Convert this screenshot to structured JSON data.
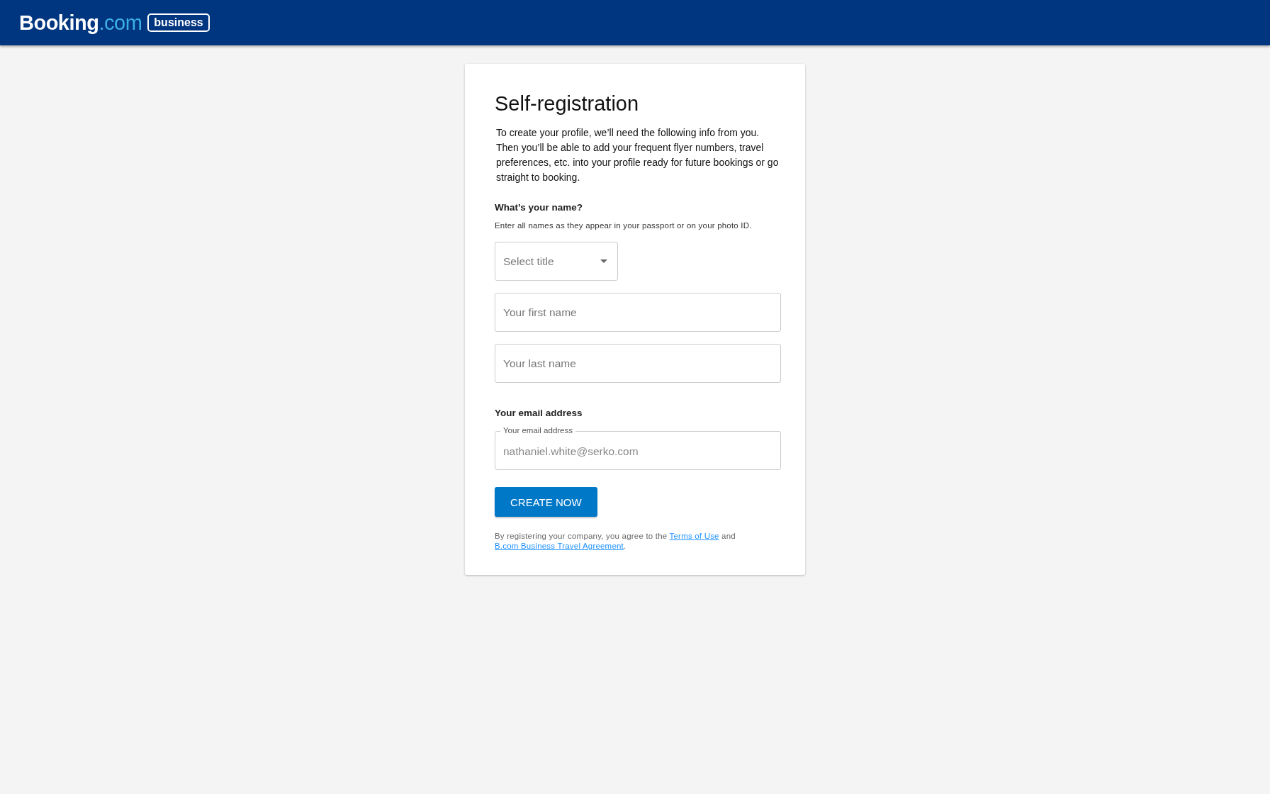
{
  "header": {
    "logo_main": "Booking",
    "logo_suffix": ".com",
    "badge": "business"
  },
  "form": {
    "title": "Self-registration",
    "intro": "To create your profile, we’ll need the following info from you. Then you’ll be able to add your frequent flyer numbers, travel preferences, etc. into your profile ready for future bookings or go straight to booking.",
    "name_heading": "What’s your name?",
    "name_hint": "Enter all names as they appear in your passport or on your photo ID.",
    "title_select": {
      "placeholder": "Select title"
    },
    "first_name": {
      "placeholder": "Your first name"
    },
    "last_name": {
      "placeholder": "Your last name"
    },
    "email_heading": "Your email address",
    "email": {
      "label": "Your email address",
      "value": "nathaniel.white@serko.com",
      "disabled": true
    },
    "submit": "CREATE NOW",
    "terms": {
      "before": "By registering your company, you agree to the ",
      "link_1": "Terms of Use",
      "middle": " and ",
      "link_2": "B.com Business Travel Agreement",
      "after": "."
    }
  }
}
